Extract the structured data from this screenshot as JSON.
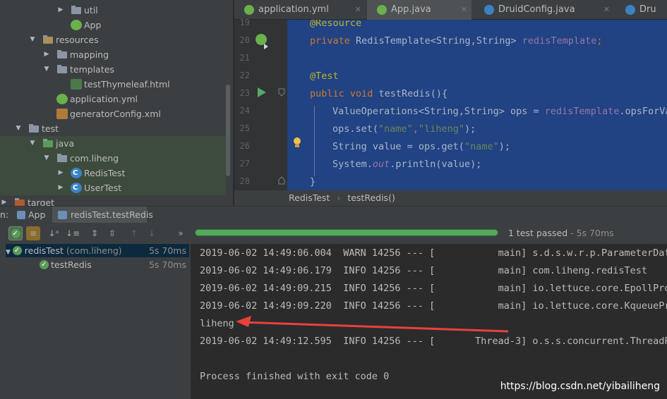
{
  "project_tree": {
    "items": [
      {
        "label": "util",
        "icon": "folder-icon"
      },
      {
        "label": "App",
        "icon": "spring-class-icon"
      },
      {
        "label": "resources",
        "icon": "resources-folder-icon"
      },
      {
        "label": "mapping",
        "icon": "folder-icon"
      },
      {
        "label": "templates",
        "icon": "folder-icon"
      },
      {
        "label": "testThymeleaf.html",
        "icon": "html-file-icon"
      },
      {
        "label": "application.yml",
        "icon": "yml-file-icon"
      },
      {
        "label": "generatorConfig.xml",
        "icon": "xml-file-icon"
      },
      {
        "label": "test",
        "icon": "folder-icon"
      },
      {
        "label": "java",
        "icon": "test-source-folder-icon"
      },
      {
        "label": "com.liheng",
        "icon": "package-icon"
      },
      {
        "label": "RedisTest",
        "icon": "class-icon"
      },
      {
        "label": "UserTest",
        "icon": "class-icon"
      },
      {
        "label": "target",
        "icon": "excluded-folder-icon"
      }
    ]
  },
  "editor": {
    "tabs": [
      "application.yml",
      "App.java",
      "DruidConfig.java",
      "Dru"
    ],
    "line_numbers": [
      "19",
      "20",
      "21",
      "22",
      "23",
      "24",
      "25",
      "26",
      "27",
      "28"
    ],
    "code": {
      "l19": "@Resource",
      "l20_kw": "private",
      "l20_type": " RedisTemplate<String,String> ",
      "l20_field": "redisTemplate",
      "l20_end": ";",
      "l22": "@Test",
      "l23_kw1": "public",
      "l23_kw2": " void",
      "l23_rest": " testRedis(){",
      "l24_a": "ValueOperations<String,String> ops = ",
      "l24_field": "redisTemplate",
      "l24_b": ".opsForVa",
      "l25_a": "ops.set(",
      "l25_s1": "\"name\"",
      "l25_c": ",",
      "l25_s2": "\"liheng\"",
      "l25_e": ");",
      "l26_a": "String value = ops.get(",
      "l26_s": "\"name\"",
      "l26_e": ");",
      "l27_a": "System.",
      "l27_out": "out",
      "l27_b": ".println(value);",
      "l28": "}"
    },
    "breadcrumb": [
      "RedisTest",
      "testRedis()"
    ]
  },
  "run_panel": {
    "tab_prefix": "n:",
    "tabs": [
      "App",
      "redisTest.testRedis"
    ],
    "status": "1 test passed",
    "status_time": " - 5s 70ms",
    "tests": [
      {
        "name": "redisTest",
        "pkg": " (com.liheng)",
        "time": "5s 70ms"
      },
      {
        "name": "testRedis",
        "pkg": "",
        "time": "5s 70ms"
      }
    ],
    "console": [
      "2019-06-02 14:49:06.004  WARN 14256 --- [           main] s.d.s.w.r.p.ParameterData",
      "2019-06-02 14:49:06.179  INFO 14256 --- [           main] com.liheng.redisTest",
      "2019-06-02 14:49:09.215  INFO 14256 --- [           main] io.lettuce.core.EpollProv",
      "2019-06-02 14:49:09.220  INFO 14256 --- [           main] io.lettuce.core.KqueuePro",
      "liheng",
      "2019-06-02 14:49:12.595  INFO 14256 --- [       Thread-3] o.s.s.concurrent.ThreadPo",
      "",
      "Process finished with exit code 0"
    ]
  },
  "watermark": "https://blog.csdn.net/yibailiheng",
  "colors": {
    "arrow": "#e8423c",
    "selection": "#214283",
    "passed_bar": "#56a85b"
  }
}
